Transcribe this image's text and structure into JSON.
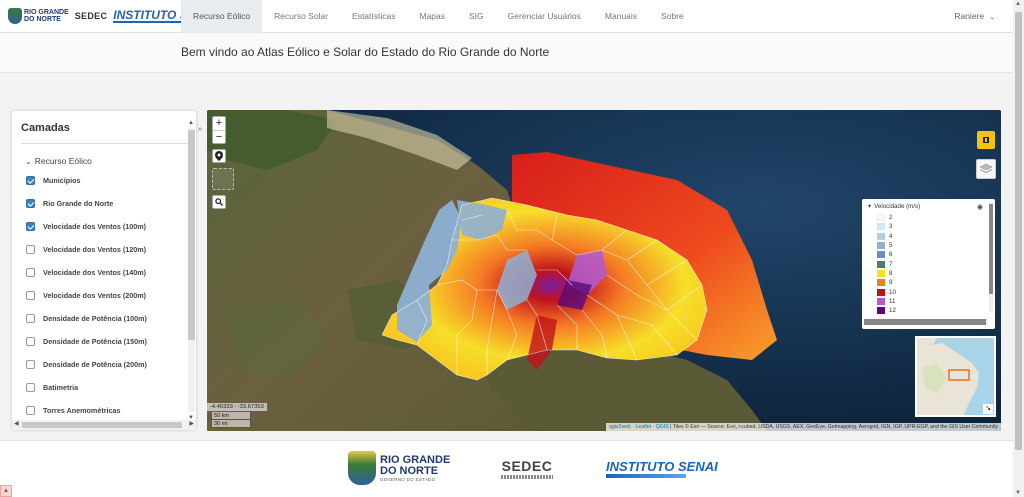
{
  "brand": {
    "rn_line1": "RIO GRANDE",
    "rn_line2": "DO NORTE",
    "sedec": "SEDEC",
    "senai": "INSTITUTO SENAI"
  },
  "nav": {
    "items": [
      {
        "label": "Recurso Eólico",
        "active": true
      },
      {
        "label": "Recurso Solar"
      },
      {
        "label": "Estatísticas"
      },
      {
        "label": "Mapas"
      },
      {
        "label": "SIG"
      },
      {
        "label": "Gerenciar Usuários"
      },
      {
        "label": "Manuais"
      },
      {
        "label": "Sobre"
      }
    ],
    "user": "Raniere"
  },
  "welcome": "Bem vindo ao Atlas Eólico e Solar do Estado do Rio Grande do Norte",
  "panel": {
    "title": "Camadas",
    "group": "Recurso Eólico",
    "layers": [
      {
        "label": "Municípios",
        "checked": true
      },
      {
        "label": "Rio Grande do Norte",
        "checked": true
      },
      {
        "label": "Velocidade dos Ventos (100m)",
        "checked": true
      },
      {
        "label": "Velocidade dos Ventos (120m)",
        "checked": false
      },
      {
        "label": "Velocidade dos Ventos (140m)",
        "checked": false
      },
      {
        "label": "Velocidade dos Ventos (200m)",
        "checked": false
      },
      {
        "label": "Densidade de Potência (100m)",
        "checked": false
      },
      {
        "label": "Densidade de Potência (150m)",
        "checked": false
      },
      {
        "label": "Densidade de Potência (200m)",
        "checked": false
      },
      {
        "label": "Batimetria",
        "checked": false
      },
      {
        "label": "Torres Anemométricas",
        "checked": false
      }
    ]
  },
  "legend": {
    "title": "Velocidade (m/s)",
    "items": [
      {
        "value": "2",
        "color": "#f7fbff"
      },
      {
        "value": "3",
        "color": "#d6e6f5"
      },
      {
        "value": "4",
        "color": "#b3cde3"
      },
      {
        "value": "5",
        "color": "#8fb0d4"
      },
      {
        "value": "6",
        "color": "#6a8fbf"
      },
      {
        "value": "7",
        "color": "#4a7f6a"
      },
      {
        "value": "8",
        "color": "#f6df2a"
      },
      {
        "value": "9",
        "color": "#f57a24"
      },
      {
        "value": "10",
        "color": "#c0121c"
      },
      {
        "value": "11",
        "color": "#b25ad6"
      },
      {
        "value": "12",
        "color": "#5a0a78"
      }
    ]
  },
  "map": {
    "coords": "-4.40333 : -33.67353",
    "scale_km": "50 km",
    "scale_mi": "30 mi",
    "attribution_link1": "qgis2web",
    "attribution_link2": "Leaflet",
    "attribution_link3": "QGIS",
    "attribution_text": "| Tiles © Esri — Source: Esri, i-cubed, USDA, USGS, AEX, GeoEye, Getmapping, Aerogrid, IGN, IGP, UPR-EGP, and the GIS User Community"
  },
  "footer": {
    "rn_line1": "RIO GRANDE",
    "rn_line2": "DO NORTE",
    "rn_sub": "GOVERNO DO ESTADO",
    "sedec": "SEDEC",
    "senai": "INSTITUTO SENAI"
  },
  "colors": {
    "accent_blue": "#1e63b5",
    "checkbox_blue": "#3b82c4",
    "map_ocean": "#0e2a44",
    "map_tool_yellow": "#f2c30f"
  },
  "icons": {
    "zoom_in": "plus-icon",
    "zoom_out": "minus-icon",
    "locate": "location-pin-icon",
    "search": "search-icon",
    "layers": "layers-icon",
    "tool": "ruler-icon",
    "expand": "expand-icon",
    "eye": "eye-icon"
  }
}
